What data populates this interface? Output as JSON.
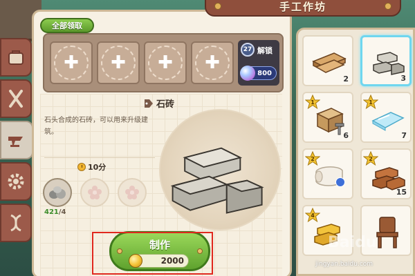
{
  "header": {
    "title": "手工作坊"
  },
  "queue": {
    "claim_all_label": "全部领取",
    "slot_count": 4,
    "unlock": {
      "level": "27",
      "label": "解锁",
      "price": "800"
    }
  },
  "item": {
    "name": "石砖",
    "description": "石头合成的石砖，可以用来升级建筑。",
    "craft_time": "10分",
    "materials": [
      {
        "name": "stone",
        "have": "421",
        "need": "4"
      }
    ]
  },
  "craft": {
    "label": "制作",
    "cost": "2000"
  },
  "inventory": {
    "items": [
      {
        "name": "wood-planks",
        "count": "2",
        "badge": "",
        "selected": false
      },
      {
        "name": "stone-brick",
        "count": "3",
        "badge": "",
        "selected": true
      },
      {
        "name": "crate-with-nail",
        "count": "6",
        "badge": "1",
        "selected": false
      },
      {
        "name": "glass-pane",
        "count": "7",
        "badge": "1",
        "selected": false
      },
      {
        "name": "cloth-roll",
        "count": "",
        "badge": "2",
        "selected": false
      },
      {
        "name": "copper-ingots",
        "count": "15",
        "badge": "2",
        "selected": false
      },
      {
        "name": "gold-ingots",
        "count": "",
        "badge": "4",
        "selected": false
      },
      {
        "name": "wooden-chair",
        "count": "",
        "badge": "",
        "selected": false
      }
    ]
  },
  "watermark": {
    "text": "jingyan.baidu.com"
  },
  "colors": {
    "accent_green": "#5fa22e",
    "selection_cyan": "#6fd6ef",
    "highlight_red": "#e0281e"
  }
}
